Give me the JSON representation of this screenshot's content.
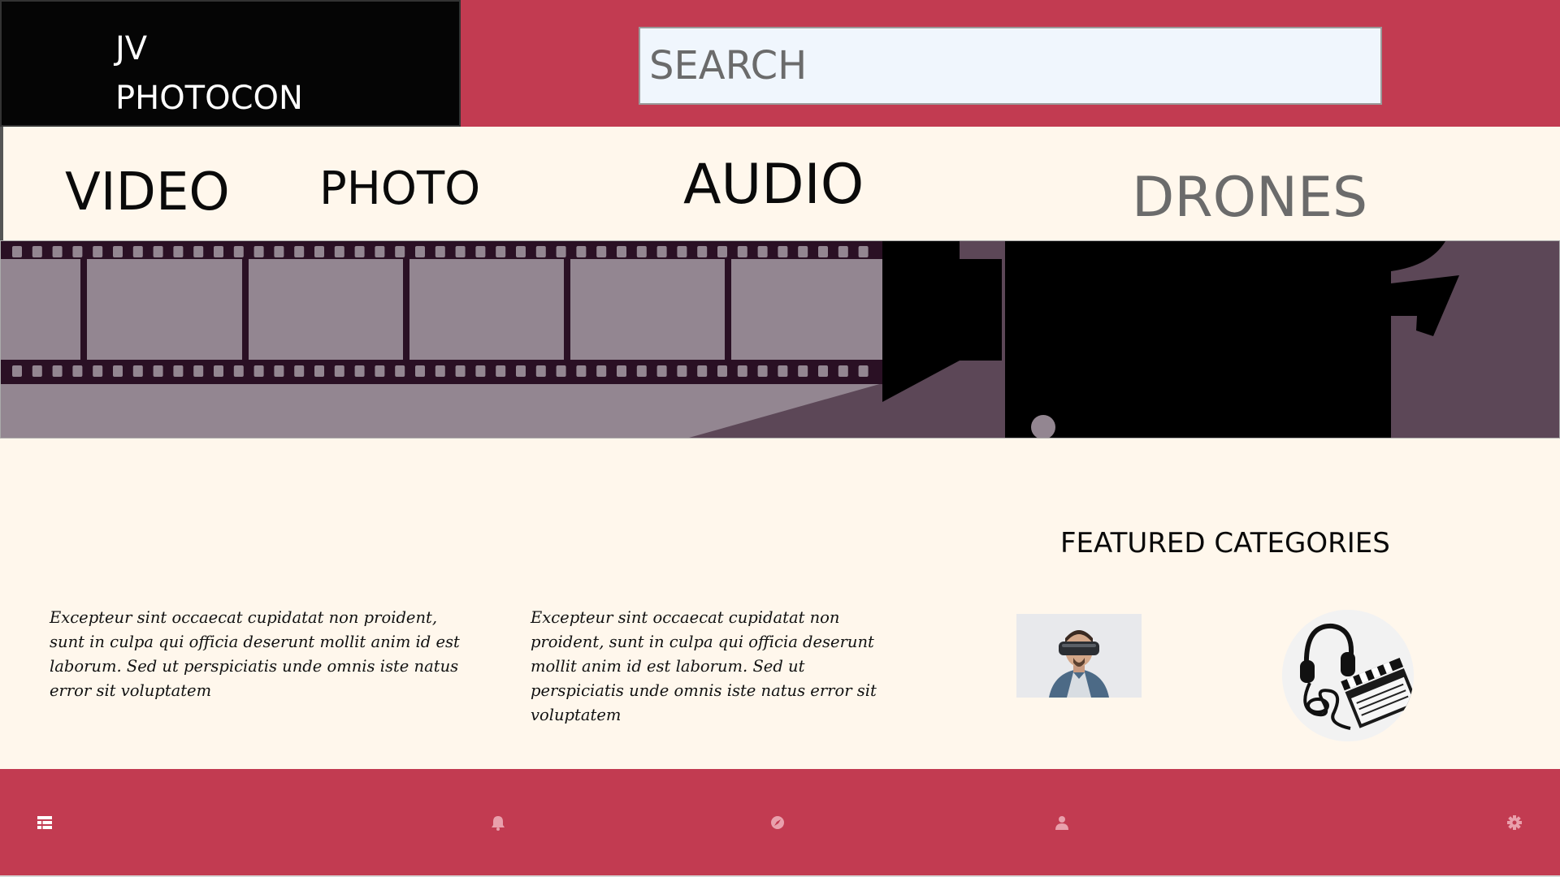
{
  "brand": {
    "line1": "JV",
    "line2": "PHOTOCON"
  },
  "search": {
    "placeholder": "SEARCH"
  },
  "nav": {
    "video": "VIDEO",
    "photo": "PHOTO",
    "audio": "AUDIO",
    "drones": "DRONES"
  },
  "featured": {
    "title": "FEATURED CATEGORIES"
  },
  "paragraphs": [
    "Excepteur sint occaecat cupidatat non proident, sunt in culpa qui officia deserunt mollit anim id est laborum. Sed ut perspiciatis unde omnis iste natus error sit voluptatem",
    "Excepteur sint occaecat cupidatat non proident, sunt in culpa qui officia deserunt mollit anim id est laborum. Sed ut perspiciatis unde omnis iste natus error sit voluptatem"
  ],
  "bottom_nav": {
    "icons": [
      "menu-icon",
      "bell-icon",
      "compass-icon",
      "user-icon",
      "gear-icon"
    ]
  },
  "colors": {
    "accent": "#c23b51",
    "background": "#fff7ec",
    "logo_bg": "#050505",
    "search_bg": "#f0f6fd",
    "hero_film": "#938691",
    "hero_shadow": "#5c4757"
  }
}
